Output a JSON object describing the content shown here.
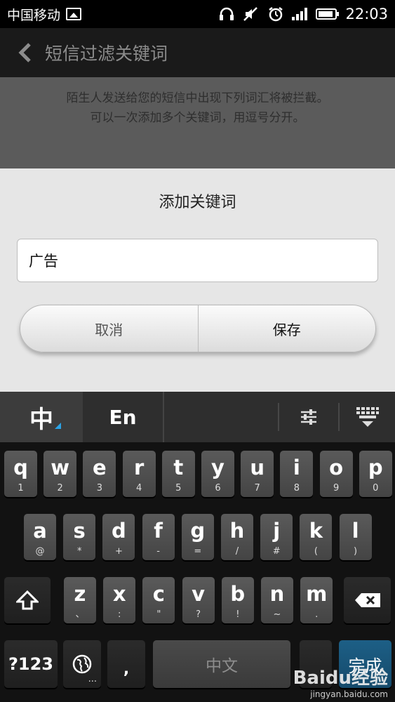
{
  "status_bar": {
    "carrier": "中国移动",
    "time": "22:03"
  },
  "title_bar": {
    "title": "短信过滤关键词"
  },
  "description": {
    "line1": "陌生人发送给您的短信中出现下列词汇将被拦截。",
    "line2": "可以一次添加多个关键词，用逗号分开。"
  },
  "dialog": {
    "title": "添加关键词",
    "input_value": "广告",
    "cancel_label": "取消",
    "save_label": "保存"
  },
  "keyboard": {
    "lang_zh": "中",
    "lang_en": "En",
    "row1": [
      {
        "main": "q",
        "sub": "1"
      },
      {
        "main": "w",
        "sub": "2"
      },
      {
        "main": "e",
        "sub": "3"
      },
      {
        "main": "r",
        "sub": "4"
      },
      {
        "main": "t",
        "sub": "5"
      },
      {
        "main": "y",
        "sub": "6"
      },
      {
        "main": "u",
        "sub": "7"
      },
      {
        "main": "i",
        "sub": "8"
      },
      {
        "main": "o",
        "sub": "9"
      },
      {
        "main": "p",
        "sub": "0"
      }
    ],
    "row2": [
      {
        "main": "a",
        "sub": "@"
      },
      {
        "main": "s",
        "sub": "*"
      },
      {
        "main": "d",
        "sub": "+"
      },
      {
        "main": "f",
        "sub": "-"
      },
      {
        "main": "g",
        "sub": "="
      },
      {
        "main": "h",
        "sub": "/"
      },
      {
        "main": "j",
        "sub": "#"
      },
      {
        "main": "k",
        "sub": "("
      },
      {
        "main": "l",
        "sub": ")"
      }
    ],
    "row3": [
      {
        "main": "z",
        "sub": "、"
      },
      {
        "main": "x",
        "sub": ":"
      },
      {
        "main": "c",
        "sub": "\""
      },
      {
        "main": "v",
        "sub": "?"
      },
      {
        "main": "b",
        "sub": "!"
      },
      {
        "main": "n",
        "sub": "~"
      },
      {
        "main": "m",
        "sub": "."
      }
    ],
    "sym_label": "?123",
    "comma_label": ",",
    "space_label": "中文",
    "done_label": "完成",
    "globe_sub": "..."
  },
  "watermark": {
    "logo": "Baidu经验",
    "url": "jingyan.baidu.com"
  },
  "colors": {
    "accent_blue": "#2ba3e6",
    "done_key": "#1d5f86",
    "dialog_bg": "#e6e6e6"
  },
  "icons": [
    "image-icon",
    "headphones-icon",
    "mute-icon",
    "alarm-icon",
    "signal-icon",
    "battery-icon",
    "back-chevron-icon",
    "keyboard-settings-icon",
    "keyboard-hide-icon",
    "shift-icon",
    "backspace-icon",
    "globe-icon"
  ]
}
